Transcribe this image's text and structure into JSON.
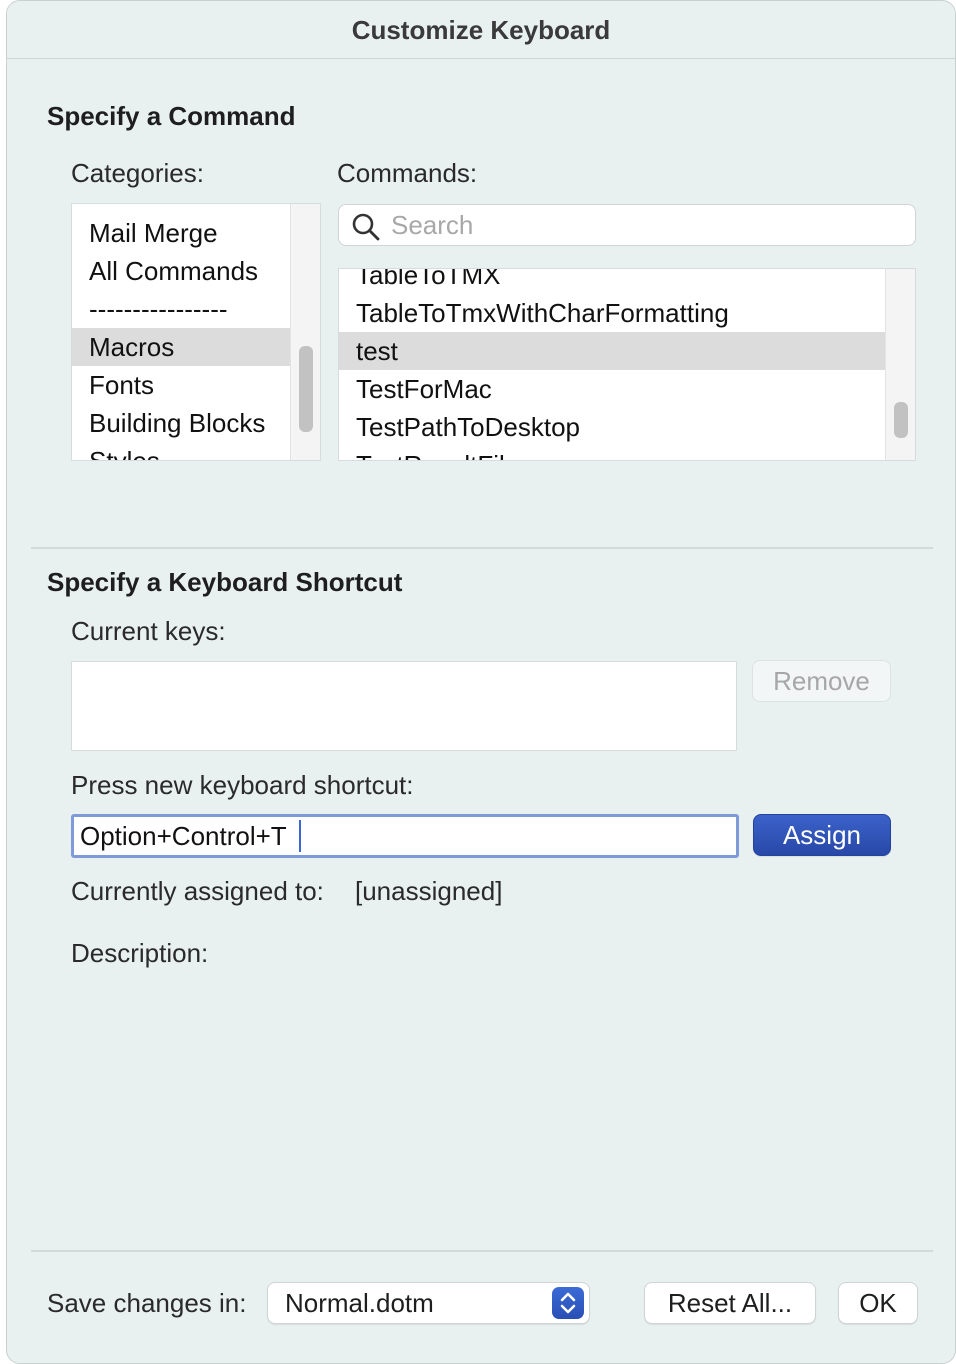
{
  "window": {
    "title": "Customize Keyboard"
  },
  "command_section": {
    "title": "Specify a Command",
    "categories_label": "Categories:",
    "commands_label": "Commands:",
    "categories": [
      {
        "label": "Mail Merge",
        "selected": false
      },
      {
        "label": "All Commands",
        "selected": false
      },
      {
        "label": "----------------",
        "selected": false
      },
      {
        "label": "Macros",
        "selected": true
      },
      {
        "label": "Fonts",
        "selected": false
      },
      {
        "label": "Building Blocks",
        "selected": false
      },
      {
        "label": "Styles",
        "selected": false
      }
    ],
    "search": {
      "placeholder": "Search",
      "value": ""
    },
    "commands": [
      {
        "label": "TableToTMX",
        "selected": false
      },
      {
        "label": "TableToTmxWithCharFormatting",
        "selected": false
      },
      {
        "label": "test",
        "selected": true
      },
      {
        "label": "TestForMac",
        "selected": false
      },
      {
        "label": "TestPathToDesktop",
        "selected": false
      },
      {
        "label": "TestResultFile",
        "selected": false
      }
    ]
  },
  "shortcut_section": {
    "title": "Specify a Keyboard Shortcut",
    "current_keys_label": "Current keys:",
    "remove_button": "Remove",
    "press_new_label": "Press new keyboard shortcut:",
    "new_shortcut_value": "Option+Control+T",
    "assign_button": "Assign",
    "currently_assigned_label": "Currently assigned to:",
    "currently_assigned_value": "[unassigned]",
    "description_label": "Description:"
  },
  "footer": {
    "save_changes_label": "Save changes in:",
    "save_changes_value": "Normal.dotm",
    "reset_all_button": "Reset All...",
    "ok_button": "OK"
  },
  "colors": {
    "window_bg": "#e8f0f0",
    "selection": "#dcdcdc",
    "primary_button": "#2f52b8",
    "focus_ring": "#7f9ad8"
  },
  "icons": {
    "search": "search-icon",
    "popup_stepper": "chevron-up-down-icon"
  }
}
